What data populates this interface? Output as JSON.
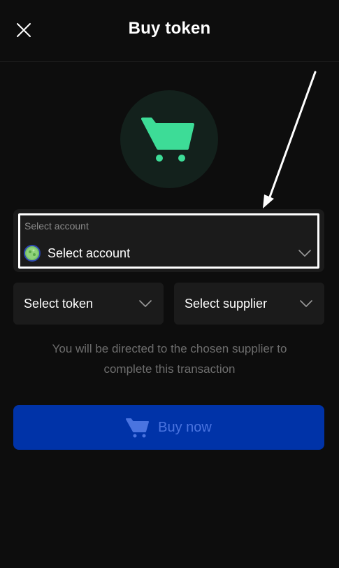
{
  "header": {
    "title": "Buy token",
    "close_icon": "close-icon"
  },
  "hero": {
    "icon": "shopping-cart-icon",
    "icon_color": "#3ddc97",
    "circle_color": "#13211c"
  },
  "account": {
    "label": "Select account",
    "value": "Select account",
    "avatar_icon": "account-avatar-icon"
  },
  "token_select": {
    "label": "Select token"
  },
  "supplier_select": {
    "label": "Select supplier"
  },
  "note": "You will be directed to the chosen supplier to complete this transaction",
  "buy_button": {
    "label": "Buy now",
    "icon": "shopping-cart-icon",
    "bg_color": "#0033a8",
    "fg_color": "#4a74e0"
  },
  "annotation": {
    "icon": "pointer-arrow-icon"
  }
}
